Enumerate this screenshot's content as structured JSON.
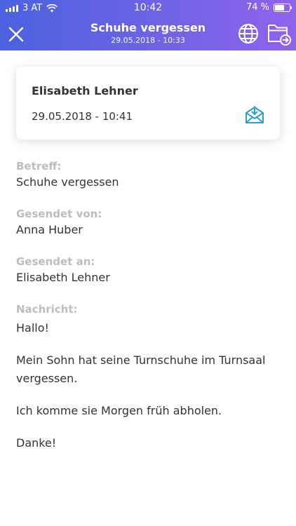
{
  "status_bar": {
    "carrier": "3 AT",
    "time": "10:42",
    "battery_percent": 74,
    "battery_label": "74 %"
  },
  "header": {
    "title": "Schuhe vergessen",
    "subtitle": "29.05.2018 - 10:33",
    "gradient_colors": [
      "#4a62e0",
      "#8f63ea"
    ]
  },
  "card": {
    "name": "Elisabeth Lehner",
    "date": "29.05.2018 - 10:41",
    "icon": "mail-download-icon",
    "icon_color": "#2d9fd1"
  },
  "fields": {
    "subject_label": "Betreff:",
    "subject": "Schuhe vergessen",
    "sender_label": "Gesendet von:",
    "sender": "Anna Huber",
    "recipient_label": "Gesendet an:",
    "recipient": "Elisabeth Lehner",
    "message_label": "Nachricht:"
  },
  "message": [
    "Hallo!",
    "Mein Sohn hat seine Turnschuhe im Turnsaal vergessen.",
    "Ich komme sie Morgen früh abholen.",
    "Danke!"
  ]
}
